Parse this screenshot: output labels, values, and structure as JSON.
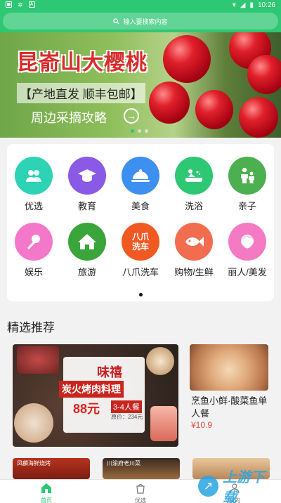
{
  "status_bar": {
    "time": "10:26"
  },
  "search": {
    "placeholder": "输入要搜索内容"
  },
  "banner": {
    "title": "昆嵛山大樱桃",
    "subtitle": "【产地直发 顺丰包邮】",
    "cta": "周边采摘攻略",
    "slide_count": 3,
    "active_slide": 1
  },
  "categories": [
    {
      "label": "优选",
      "icon": "users-icon",
      "color": "#2ed3b5"
    },
    {
      "label": "教育",
      "icon": "graduation-cap-icon",
      "color": "#8a5ae6"
    },
    {
      "label": "美食",
      "icon": "food-cloche-icon",
      "color": "#3d8ff0"
    },
    {
      "label": "洗浴",
      "icon": "bath-icon",
      "color": "#2ec773"
    },
    {
      "label": "亲子",
      "icon": "parent-child-icon",
      "color": "#4caf50"
    },
    {
      "label": "娱乐",
      "icon": "microphone-icon",
      "color": "#f478c9"
    },
    {
      "label": "旅游",
      "icon": "house-icon",
      "color": "#3aa53a"
    },
    {
      "label": "八爪洗车",
      "icon": "car-wash-logo-icon",
      "color": "#f05a22",
      "logo_text": "八爪\n洗车"
    },
    {
      "label": "购物/生鲜",
      "icon": "fish-icon",
      "color": "#f26c4f"
    },
    {
      "label": "丽人/美发",
      "icon": "woman-face-icon",
      "color": "#f47ac3"
    }
  ],
  "section": {
    "title": "精选推荐"
  },
  "featured": {
    "brand": "味禧",
    "headline": "炭火烤肉料理",
    "price": "88元",
    "portion": "3-4人餐",
    "original_price": "原价：234元"
  },
  "side_item": {
    "name": "烹鱼小鲜·酸菜鱼单人餐",
    "price": "¥10.9"
  },
  "second_row": [
    {
      "label": "凤麟海鲜烧烤"
    },
    {
      "label": "川渝府老川菜"
    }
  ],
  "tabs": [
    {
      "label": "首页",
      "icon": "home-icon",
      "active": true
    },
    {
      "label": "优选",
      "icon": "shopping-bag-icon",
      "active": false
    },
    {
      "label": "我的",
      "icon": "profile-icon",
      "active": false
    }
  ],
  "watermark": {
    "text": "上游下载"
  },
  "colors": {
    "primary": "#2ec773",
    "price": "#e54b3b"
  }
}
